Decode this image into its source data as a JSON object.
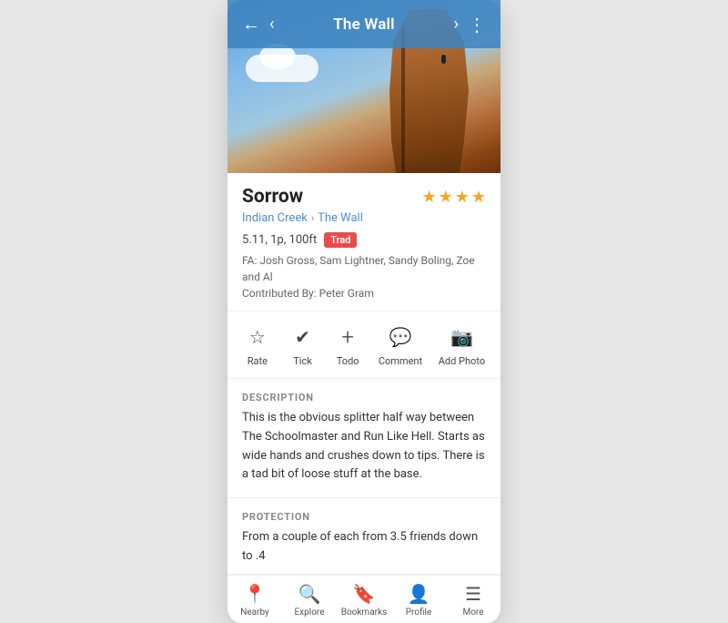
{
  "header": {
    "back_label": "←",
    "prev_label": "‹",
    "title": "The Wall",
    "next_label": "›",
    "more_label": "⋮"
  },
  "route": {
    "name": "Sorrow",
    "breadcrumb_part1": "Indian Creek",
    "breadcrumb_sep": "›",
    "breadcrumb_part2": "The Wall",
    "meta": "5.11, 1p, 100ft",
    "type_badge": "Trad",
    "fa": "FA: Josh Gross, Sam Lightner, Sandy Boling, Zoe and Al",
    "contributed": "Contributed By: Peter Gram",
    "stars_filled": 4,
    "stars_total": 4
  },
  "actions": [
    {
      "icon": "☆",
      "label": "Rate"
    },
    {
      "icon": "✔",
      "label": "Tick"
    },
    {
      "icon": "+",
      "label": "Todo"
    },
    {
      "icon": "💬",
      "label": "Comment"
    },
    {
      "icon": "📷",
      "label": "Add Photo"
    }
  ],
  "description": {
    "title": "DESCRIPTION",
    "body": "This is the obvious splitter half way between The Schoolmaster and Run Like Hell. Starts as wide hands and crushes down to tips. There is a tad bit of loose stuff at the base."
  },
  "protection": {
    "title": "PROTECTION",
    "body": "From a couple of each from 3.5 friends down to .4"
  },
  "nav": [
    {
      "icon": "📍",
      "label": "Nearby"
    },
    {
      "icon": "🔍",
      "label": "Explore"
    },
    {
      "icon": "🔖",
      "label": "Bookmarks"
    },
    {
      "icon": "👤",
      "label": "Profile"
    },
    {
      "icon": "☰",
      "label": "More"
    }
  ],
  "colors": {
    "accent_blue": "#4a90d9",
    "trad_red": "#e74c4c",
    "star_gold": "#f5a623",
    "nav_bg": "#ffffff",
    "header_bg": "rgba(60,130,190,0.85)"
  }
}
